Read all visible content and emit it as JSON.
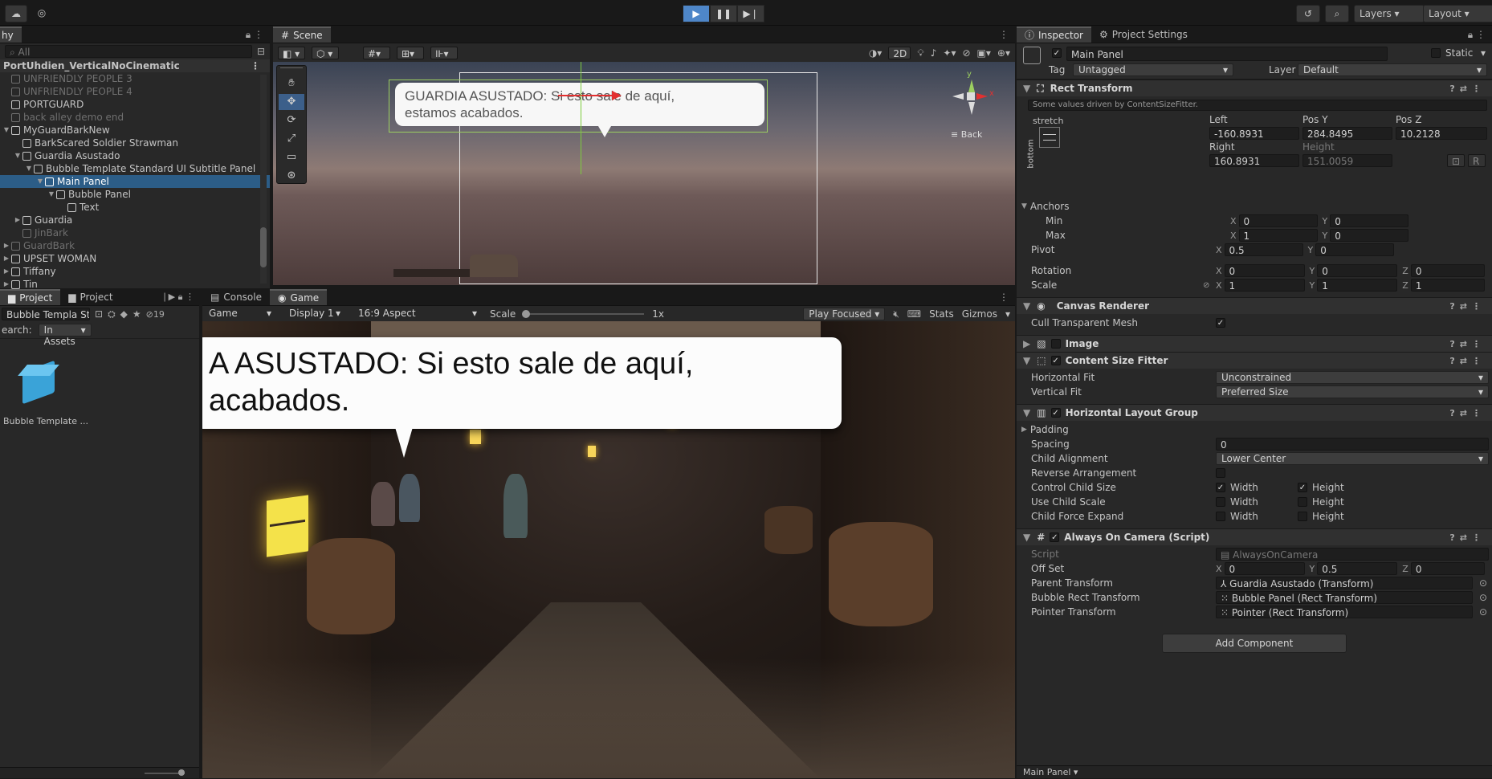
{
  "toolbar": {
    "layers_label": "Layers",
    "layout_label": "Layout"
  },
  "hierarchy": {
    "tab_label": "hy",
    "search_placeholder": "All",
    "scene_name": "PortUhdien_VerticalNoCinematic",
    "items": [
      {
        "label": "UNFRIENDLY PEOPLE 3",
        "depth": 0,
        "dim": true
      },
      {
        "label": "UNFRIENDLY PEOPLE 4",
        "depth": 0,
        "dim": true
      },
      {
        "label": "PORTGUARD",
        "depth": 0,
        "dim": false
      },
      {
        "label": "back alley demo end",
        "depth": 0,
        "dim": true
      },
      {
        "label": "MyGuardBarkNew",
        "depth": 0,
        "dim": false
      },
      {
        "label": "BarkScared Soldier Strawman",
        "depth": 1,
        "dim": false
      },
      {
        "label": "Guardia Asustado",
        "depth": 1,
        "dim": false
      },
      {
        "label": "Bubble Template Standard UI Subtitle Panel",
        "depth": 2,
        "dim": false
      },
      {
        "label": "Main Panel",
        "depth": 3,
        "dim": false,
        "selected": true
      },
      {
        "label": "Bubble Panel",
        "depth": 4,
        "dim": false
      },
      {
        "label": "Text",
        "depth": 5,
        "dim": false
      },
      {
        "label": "Guardia",
        "depth": 1,
        "dim": false
      },
      {
        "label": "JinBark",
        "depth": 1,
        "dim": true
      },
      {
        "label": "GuardBark",
        "depth": 0,
        "dim": true
      },
      {
        "label": "UPSET WOMAN",
        "depth": 0,
        "dim": false
      },
      {
        "label": "Tiffany",
        "depth": 0,
        "dim": false
      },
      {
        "label": "Tin",
        "depth": 0,
        "dim": false
      }
    ]
  },
  "scene": {
    "tab_label": "Scene",
    "toolbar_2d": "2D",
    "back_label": "Back",
    "gizmo_y": "y",
    "gizmo_x": "x",
    "bubble_text_line1": "GUARDIA ASUSTADO: Si esto sale de aquí,",
    "bubble_text_line2": "estamos acabados."
  },
  "project": {
    "tabs": [
      "Project",
      "Project"
    ],
    "search_value": "Bubble Templa Sta×",
    "hidden_count": "19",
    "search_label": "earch:",
    "search_scope": "In Assets",
    "asset_label": "Bubble Template ..."
  },
  "game": {
    "tabs": [
      "Console",
      "Game"
    ],
    "mode": "Game",
    "display": "Display 1",
    "aspect": "16:9 Aspect",
    "scale_label": "Scale",
    "scale_value": "1x",
    "play_focused": "Play Focused",
    "stats": "Stats",
    "gizmos": "Gizmos",
    "bubble_line1": "A ASUSTADO: Si esto sale de aquí,",
    "bubble_line2": "acabados."
  },
  "inspector": {
    "tabs": [
      "Inspector",
      "Project Settings"
    ],
    "object_name": "Main Panel",
    "static_label": "Static",
    "tag_label": "Tag",
    "tag_value": "Untagged",
    "layer_label": "Layer",
    "layer_value": "Default",
    "rect_transform": {
      "title": "Rect Transform",
      "note": "Some values driven by ContentSizeFitter.",
      "stretch": "stretch",
      "bottom": "bottom",
      "left_label": "Left",
      "posy_label": "Pos Y",
      "posz_label": "Pos Z",
      "left": "-160.8931",
      "posy": "284.8495",
      "posz": "10.2128",
      "right_label": "Right",
      "height_label": "Height",
      "right": "160.8931",
      "height": "151.0059",
      "anchors": "Anchors",
      "min_label": "Min",
      "max_label": "Max",
      "pivot_label": "Pivot",
      "rotation_label": "Rotation",
      "scale_label": "Scale",
      "x_axis": "X",
      "y_axis": "Y",
      "z_axis": "Z",
      "min_x": "0",
      "min_y": "0",
      "max_x": "1",
      "max_y": "0",
      "pivot_x": "0.5",
      "pivot_y": "0",
      "rot_x": "0",
      "rot_y": "0",
      "rot_z": "0",
      "scale_x": "1",
      "scale_y": "1",
      "scale_z": "1",
      "raw_btn": "R"
    },
    "canvas_renderer": {
      "title": "Canvas Renderer",
      "cull_label": "Cull Transparent Mesh"
    },
    "image": {
      "title": "Image"
    },
    "content_size_fitter": {
      "title": "Content Size Fitter",
      "hfit_label": "Horizontal Fit",
      "hfit": "Unconstrained",
      "vfit_label": "Vertical Fit",
      "vfit": "Preferred Size"
    },
    "hlg": {
      "title": "Horizontal Layout Group",
      "padding": "Padding",
      "spacing_label": "Spacing",
      "spacing": "0",
      "child_alignment_label": "Child Alignment",
      "child_alignment": "Lower Center",
      "reverse_label": "Reverse Arrangement",
      "control_label": "Control Child Size",
      "use_scale_label": "Use Child Scale",
      "force_expand_label": "Child Force Expand",
      "width": "Width",
      "height": "Height"
    },
    "always_on_camera": {
      "title": "Always On Camera (Script)",
      "script_label": "Script",
      "script": "AlwaysOnCamera",
      "offset_label": "Off Set",
      "off_x": "0",
      "off_y": "0.5",
      "off_z": "0",
      "parent_label": "Parent Transform",
      "parent": "Guardia Asustado (Transform)",
      "bubble_label": "Bubble Rect Transform",
      "bubble": "Bubble Panel (Rect Transform)",
      "pointer_label": "Pointer Transform",
      "pointer": "Pointer (Rect Transform)"
    },
    "add_component": "Add Component",
    "footer": "Main Panel"
  }
}
